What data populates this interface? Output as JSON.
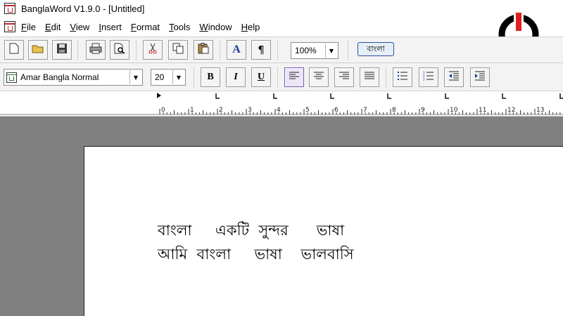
{
  "window": {
    "title": "BanglaWord V1.9.0 - [Untitled]"
  },
  "menu": {
    "items": [
      "File",
      "Edit",
      "View",
      "Insert",
      "Format",
      "Tools",
      "Window",
      "Help"
    ]
  },
  "toolbar": {
    "zoom": "100%",
    "bangla_label": "বাংলা",
    "font_letter": "A",
    "para_mark": "¶"
  },
  "format_bar": {
    "font_name": "Amar Bangla Normal",
    "font_size": "20",
    "bold": "B",
    "italic": "I",
    "underline": "U"
  },
  "ruler": {
    "labels": [
      "0",
      "1",
      "2",
      "3",
      "4",
      "5",
      "6",
      "7",
      "8",
      "9",
      "10",
      "11",
      "12",
      "13"
    ]
  },
  "document": {
    "lines": [
      "বাংলা     একটি  সুন্দর      ভাষা",
      "আমি  বাংলা     ভাষা    ভালবাসি"
    ]
  },
  "colors": {
    "workspace": "#808080",
    "logo_red": "#e02020",
    "accent_purple": "#7b5bb8"
  },
  "icons": [
    "new-document-icon",
    "open-folder-icon",
    "save-icon",
    "print-icon",
    "print-preview-icon",
    "cut-icon",
    "copy-icon",
    "paste-icon",
    "font-icon",
    "paragraph-icon",
    "bold-icon",
    "italic-icon",
    "underline-icon",
    "align-left-icon",
    "align-center-icon",
    "align-right-icon",
    "justify-icon",
    "bullet-list-icon",
    "numbered-list-icon",
    "decrease-indent-icon",
    "increase-indent-icon",
    "power-logo-icon"
  ]
}
